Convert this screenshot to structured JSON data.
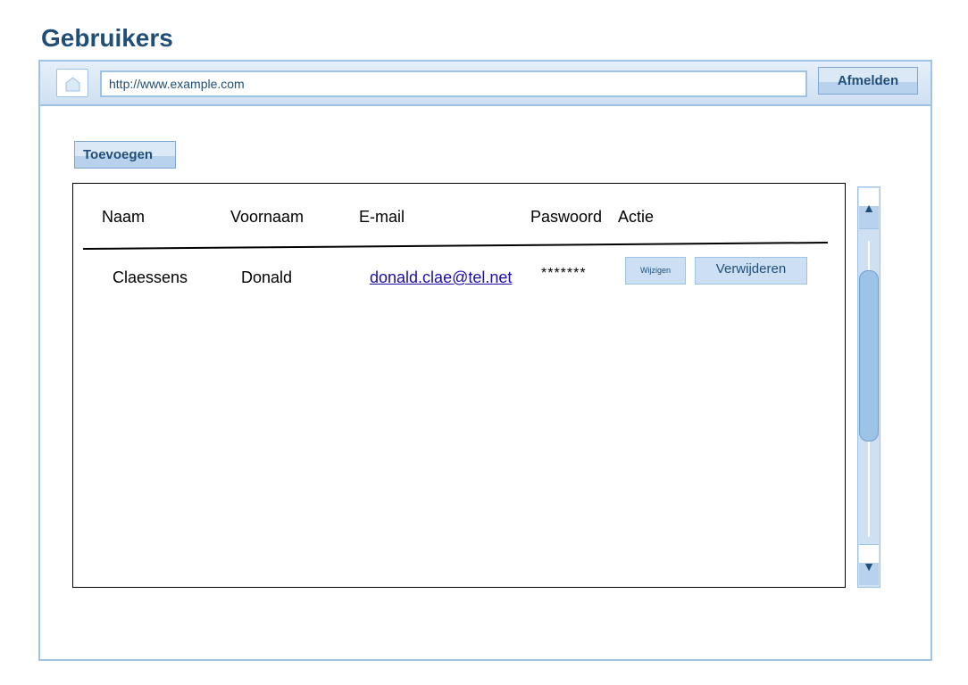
{
  "page": {
    "title": "Gebruikers"
  },
  "browser": {
    "url": "http://www.example.com",
    "logout_label": "Afmelden",
    "home_icon": "home-icon"
  },
  "toolbar": {
    "add_label": "Toevoegen"
  },
  "table": {
    "columns": [
      "Naam",
      "Voornaam",
      "E-mail",
      "Paswoord",
      "Actie"
    ],
    "rows": [
      {
        "naam": "Claessens",
        "voornaam": "Donald",
        "email": "donald.clae@tel.net",
        "paswoord": "*******",
        "edit_label": "Wijzigen",
        "delete_label": "Verwijderen"
      }
    ]
  },
  "scrollbar": {
    "up_arrow": "▲",
    "down_arrow": "▼"
  },
  "colors": {
    "accent": "#1f4e79",
    "border": "#9dc3e6",
    "button_fill": "#cde0f3"
  }
}
